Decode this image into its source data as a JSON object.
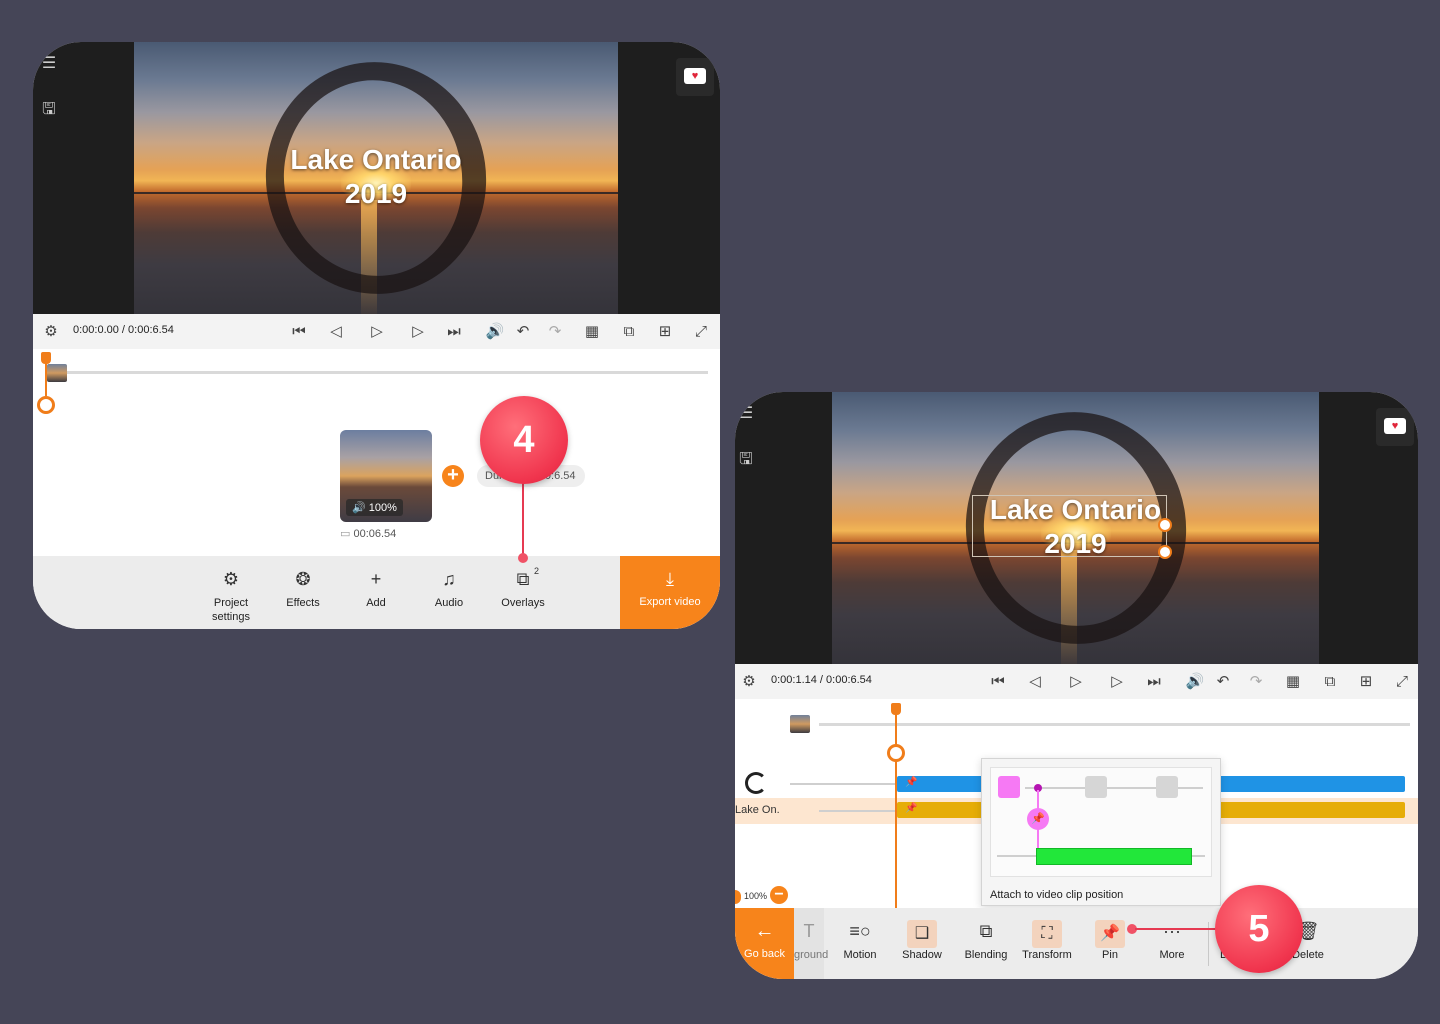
{
  "panel1": {
    "video_title_line1": "Lake Ontario",
    "video_title_line2": "2019",
    "time": "0:00:0.00 / 0:00:6.54",
    "clip": {
      "volume": "🔊 100%",
      "duration": "00:06.54"
    },
    "duration_pill": "Duration 0:00:6.54",
    "toolbar": [
      {
        "icon": "gear-icon",
        "label": "Project settings"
      },
      {
        "icon": "effects-icon",
        "label": "Effects"
      },
      {
        "icon": "plus-icon",
        "label": "Add"
      },
      {
        "icon": "music-icon",
        "label": "Audio"
      },
      {
        "icon": "layers-icon",
        "label": "Overlays"
      }
    ],
    "overlays_count": "2",
    "export_label": "Export video",
    "step_badge": "4"
  },
  "panel2": {
    "video_title_line1": "Lake Ontario",
    "video_title_line2": "2019",
    "time": "0:00:1.14 / 0:00:6.54",
    "track_label": "Lake On.",
    "zoom_label": "100%",
    "popup_caption": "Attach to video clip position",
    "goback_label": "Go back",
    "background_label": "ground",
    "toolbar": [
      {
        "icon": "motion-icon",
        "label": "Motion"
      },
      {
        "icon": "shadow-icon",
        "label": "Shadow"
      },
      {
        "icon": "blending-icon",
        "label": "Blending"
      },
      {
        "icon": "transform-icon",
        "label": "Transform"
      },
      {
        "icon": "pin-icon",
        "label": "Pin"
      },
      {
        "icon": "more-icon",
        "label": "More"
      }
    ],
    "duplicate_label": "D",
    "delete_label": "Delete",
    "step_badge": "5"
  },
  "colors": {
    "background": "#454557",
    "accent": "#f7841b",
    "badge": "#f0344d",
    "overlay_track_blue": "#1f93e5",
    "text_track_yellow": "#e6ad07",
    "keyframe_pink": "#f679f4",
    "pin_bar_green": "#22e73a"
  }
}
